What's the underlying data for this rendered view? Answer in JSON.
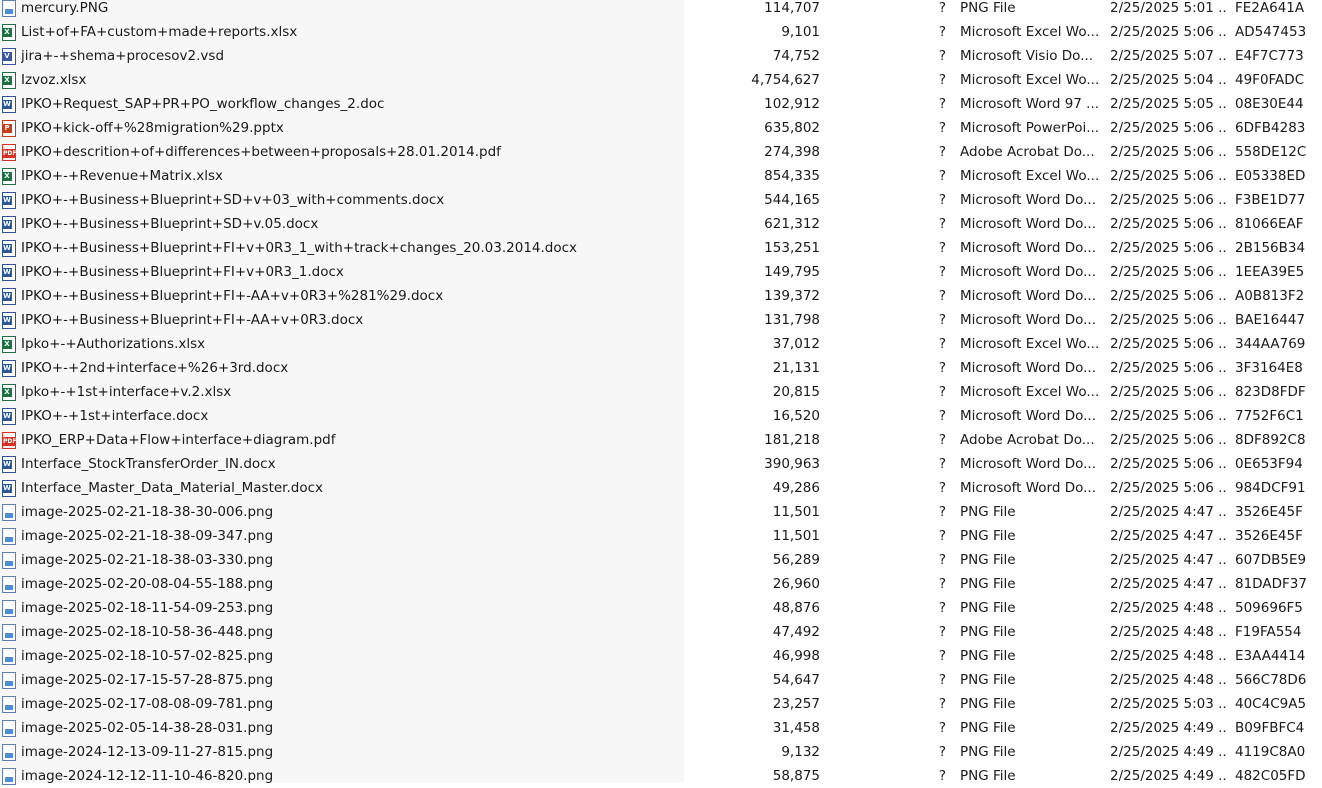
{
  "icons": {
    "png": "image-file-icon",
    "xlsx": "excel-file-icon",
    "doc": "word-file-icon",
    "pdf": "pdf-file-icon",
    "ppt": "powerpoint-file-icon",
    "vsd": "visio-file-icon"
  },
  "icon_badges": {
    "xlsx": "X",
    "doc": "W",
    "pdf": "PDF",
    "ppt": "P",
    "vsd": "V"
  },
  "files": [
    {
      "icon": "png",
      "name": "mercury.PNG",
      "size": "114,707",
      "status": "?",
      "type": "PNG File",
      "date": "2/25/2025 5:01 ...",
      "crc": "FE2A641A"
    },
    {
      "icon": "xlsx",
      "name": "List+of+FA+custom+made+reports.xlsx",
      "size": "9,101",
      "status": "?",
      "type": "Microsoft Excel Wo...",
      "date": "2/25/2025 5:06 ...",
      "crc": "AD547453"
    },
    {
      "icon": "vsd",
      "name": "jira+-+shema+procesov2.vsd",
      "size": "74,752",
      "status": "?",
      "type": "Microsoft Visio Do...",
      "date": "2/25/2025 5:07 ...",
      "crc": "E4F7C773"
    },
    {
      "icon": "xlsx",
      "name": "Izvoz.xlsx",
      "size": "4,754,627",
      "status": "?",
      "type": "Microsoft Excel Wo...",
      "date": "2/25/2025 5:04 ...",
      "crc": "49F0FADC"
    },
    {
      "icon": "doc",
      "name": "IPKO+Request_SAP+PR+PO_workflow_changes_2.doc",
      "size": "102,912",
      "status": "?",
      "type": "Microsoft Word 97 ...",
      "date": "2/25/2025 5:05 ...",
      "crc": "08E30E44"
    },
    {
      "icon": "ppt",
      "name": "IPKO+kick-off+%28migration%29.pptx",
      "size": "635,802",
      "status": "?",
      "type": "Microsoft PowerPoi...",
      "date": "2/25/2025 5:06 ...",
      "crc": "6DFB4283"
    },
    {
      "icon": "pdf",
      "name": "IPKO+descrition+of+differences+between+proposals+28.01.2014.pdf",
      "size": "274,398",
      "status": "?",
      "type": "Adobe Acrobat Do...",
      "date": "2/25/2025 5:06 ...",
      "crc": "558DE12C"
    },
    {
      "icon": "xlsx",
      "name": "IPKO+-+Revenue+Matrix.xlsx",
      "size": "854,335",
      "status": "?",
      "type": "Microsoft Excel Wo...",
      "date": "2/25/2025 5:06 ...",
      "crc": "E05338ED"
    },
    {
      "icon": "doc",
      "name": "IPKO+-+Business+Blueprint+SD+v+03_with+comments.docx",
      "size": "544,165",
      "status": "?",
      "type": "Microsoft Word Do...",
      "date": "2/25/2025 5:06 ...",
      "crc": "F3BE1D77"
    },
    {
      "icon": "doc",
      "name": "IPKO+-+Business+Blueprint+SD+v.05.docx",
      "size": "621,312",
      "status": "?",
      "type": "Microsoft Word Do...",
      "date": "2/25/2025 5:06 ...",
      "crc": "81066EAF"
    },
    {
      "icon": "doc",
      "name": "IPKO+-+Business+Blueprint+FI+v+0R3_1_with+track+changes_20.03.2014.docx",
      "size": "153,251",
      "status": "?",
      "type": "Microsoft Word Do...",
      "date": "2/25/2025 5:06 ...",
      "crc": "2B156B34"
    },
    {
      "icon": "doc",
      "name": "IPKO+-+Business+Blueprint+FI+v+0R3_1.docx",
      "size": "149,795",
      "status": "?",
      "type": "Microsoft Word Do...",
      "date": "2/25/2025 5:06 ...",
      "crc": "1EEA39E5"
    },
    {
      "icon": "doc",
      "name": "IPKO+-+Business+Blueprint+FI+-AA+v+0R3+%281%29.docx",
      "size": "139,372",
      "status": "?",
      "type": "Microsoft Word Do...",
      "date": "2/25/2025 5:06 ...",
      "crc": "A0B813F2"
    },
    {
      "icon": "doc",
      "name": "IPKO+-+Business+Blueprint+FI+-AA+v+0R3.docx",
      "size": "131,798",
      "status": "?",
      "type": "Microsoft Word Do...",
      "date": "2/25/2025 5:06 ...",
      "crc": "BAE16447"
    },
    {
      "icon": "xlsx",
      "name": "Ipko+-+Authorizations.xlsx",
      "size": "37,012",
      "status": "?",
      "type": "Microsoft Excel Wo...",
      "date": "2/25/2025 5:06 ...",
      "crc": "344AA769"
    },
    {
      "icon": "doc",
      "name": "IPKO+-+2nd+interface+%26+3rd.docx",
      "size": "21,131",
      "status": "?",
      "type": "Microsoft Word Do...",
      "date": "2/25/2025 5:06 ...",
      "crc": "3F3164E8"
    },
    {
      "icon": "xlsx",
      "name": "Ipko+-+1st+interface+v.2.xlsx",
      "size": "20,815",
      "status": "?",
      "type": "Microsoft Excel Wo...",
      "date": "2/25/2025 5:06 ...",
      "crc": "823D8FDF"
    },
    {
      "icon": "doc",
      "name": "IPKO+-+1st+interface.docx",
      "size": "16,520",
      "status": "?",
      "type": "Microsoft Word Do...",
      "date": "2/25/2025 5:06 ...",
      "crc": "7752F6C1"
    },
    {
      "icon": "pdf",
      "name": "IPKO_ERP+Data+Flow+interface+diagram.pdf",
      "size": "181,218",
      "status": "?",
      "type": "Adobe Acrobat Do...",
      "date": "2/25/2025 5:06 ...",
      "crc": "8DF892C8"
    },
    {
      "icon": "doc",
      "name": "Interface_StockTransferOrder_IN.docx",
      "size": "390,963",
      "status": "?",
      "type": "Microsoft Word Do...",
      "date": "2/25/2025 5:06 ...",
      "crc": "0E653F94"
    },
    {
      "icon": "doc",
      "name": "Interface_Master_Data_Material_Master.docx",
      "size": "49,286",
      "status": "?",
      "type": "Microsoft Word Do...",
      "date": "2/25/2025 5:06 ...",
      "crc": "984DCF91"
    },
    {
      "icon": "png",
      "name": "image-2025-02-21-18-38-30-006.png",
      "size": "11,501",
      "status": "?",
      "type": "PNG File",
      "date": "2/25/2025 4:47 ...",
      "crc": "3526E45F"
    },
    {
      "icon": "png",
      "name": "image-2025-02-21-18-38-09-347.png",
      "size": "11,501",
      "status": "?",
      "type": "PNG File",
      "date": "2/25/2025 4:47 ...",
      "crc": "3526E45F"
    },
    {
      "icon": "png",
      "name": "image-2025-02-21-18-38-03-330.png",
      "size": "56,289",
      "status": "?",
      "type": "PNG File",
      "date": "2/25/2025 4:47 ...",
      "crc": "607DB5E9"
    },
    {
      "icon": "png",
      "name": "image-2025-02-20-08-04-55-188.png",
      "size": "26,960",
      "status": "?",
      "type": "PNG File",
      "date": "2/25/2025 4:47 ...",
      "crc": "81DADF37"
    },
    {
      "icon": "png",
      "name": "image-2025-02-18-11-54-09-253.png",
      "size": "48,876",
      "status": "?",
      "type": "PNG File",
      "date": "2/25/2025 4:48 ...",
      "crc": "509696F5"
    },
    {
      "icon": "png",
      "name": "image-2025-02-18-10-58-36-448.png",
      "size": "47,492",
      "status": "?",
      "type": "PNG File",
      "date": "2/25/2025 4:48 ...",
      "crc": "F19FA554"
    },
    {
      "icon": "png",
      "name": "image-2025-02-18-10-57-02-825.png",
      "size": "46,998",
      "status": "?",
      "type": "PNG File",
      "date": "2/25/2025 4:48 ...",
      "crc": "E3AA4414"
    },
    {
      "icon": "png",
      "name": "image-2025-02-17-15-57-28-875.png",
      "size": "54,647",
      "status": "?",
      "type": "PNG File",
      "date": "2/25/2025 4:48 ...",
      "crc": "566C78D6"
    },
    {
      "icon": "png",
      "name": "image-2025-02-17-08-08-09-781.png",
      "size": "23,257",
      "status": "?",
      "type": "PNG File",
      "date": "2/25/2025 5:03 ...",
      "crc": "40C4C9A5"
    },
    {
      "icon": "png",
      "name": "image-2025-02-05-14-38-28-031.png",
      "size": "31,458",
      "status": "?",
      "type": "PNG File",
      "date": "2/25/2025 4:49 ...",
      "crc": "B09FBFC4"
    },
    {
      "icon": "png",
      "name": "image-2024-12-13-09-11-27-815.png",
      "size": "9,132",
      "status": "?",
      "type": "PNG File",
      "date": "2/25/2025 4:49 ...",
      "crc": "4119C8A0"
    },
    {
      "icon": "png",
      "name": "image-2024-12-12-11-10-46-820.png",
      "size": "58,875",
      "status": "?",
      "type": "PNG File",
      "date": "2/25/2025 4:49 ...",
      "crc": "482C05FD"
    }
  ]
}
